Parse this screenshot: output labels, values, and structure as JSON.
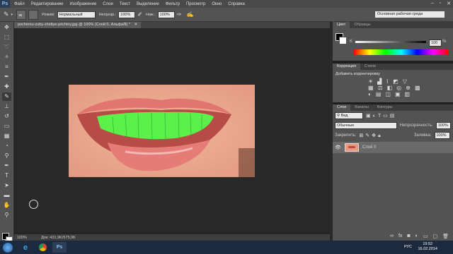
{
  "menubar": {
    "logo": "Ps",
    "items": [
      "Файл",
      "Редактирование",
      "Изображение",
      "Слои",
      "Текст",
      "Выделение",
      "Фильтр",
      "Просмотр",
      "Окно",
      "Справка"
    ],
    "minimize": "–",
    "maximize": "▫",
    "close": "✕"
  },
  "options": {
    "size_value": "36",
    "mode_label": "Режим:",
    "mode_value": "Нормальный",
    "opacity_label": "Непрозр.:",
    "opacity_value": "100%",
    "pressure_label": "Наж.:",
    "pressure_value": "100%",
    "workspace": "Основная рабочая среда"
  },
  "document": {
    "tab_title": "pochemu-zuby-zheltye-prichiny.jpg @ 100% (Слой 0, Альфа/8) *",
    "zoom": "100%",
    "doc_info": "Док: 431,9K/575,9K"
  },
  "color_panel": {
    "tabs": [
      "Цвет",
      "Образцы"
    ],
    "channel": "K",
    "value": "100",
    "unit": "%"
  },
  "adjustments_panel": {
    "tabs": [
      "Коррекция",
      "Стили"
    ],
    "title": "Добавить корректировку"
  },
  "layers_panel": {
    "tabs": [
      "Слои",
      "Каналы",
      "Контуры"
    ],
    "filter_kind": "Вид",
    "blend_mode": "Обычные",
    "opacity_label": "Непрозрачность:",
    "opacity_value": "100%",
    "lock_label": "Закрепить:",
    "fill_label": "Заливка:",
    "fill_value": "100%",
    "layers": [
      {
        "name": "Слой 0",
        "visible": true
      }
    ]
  },
  "taskbar": {
    "lang": "РУС",
    "time": "19:52",
    "date": "16.02.2014",
    "ps_label": "Ps"
  },
  "colors": {
    "accent": "#2b3e56",
    "teeth_green": "#5cf04a",
    "lips": "#e87a74"
  }
}
